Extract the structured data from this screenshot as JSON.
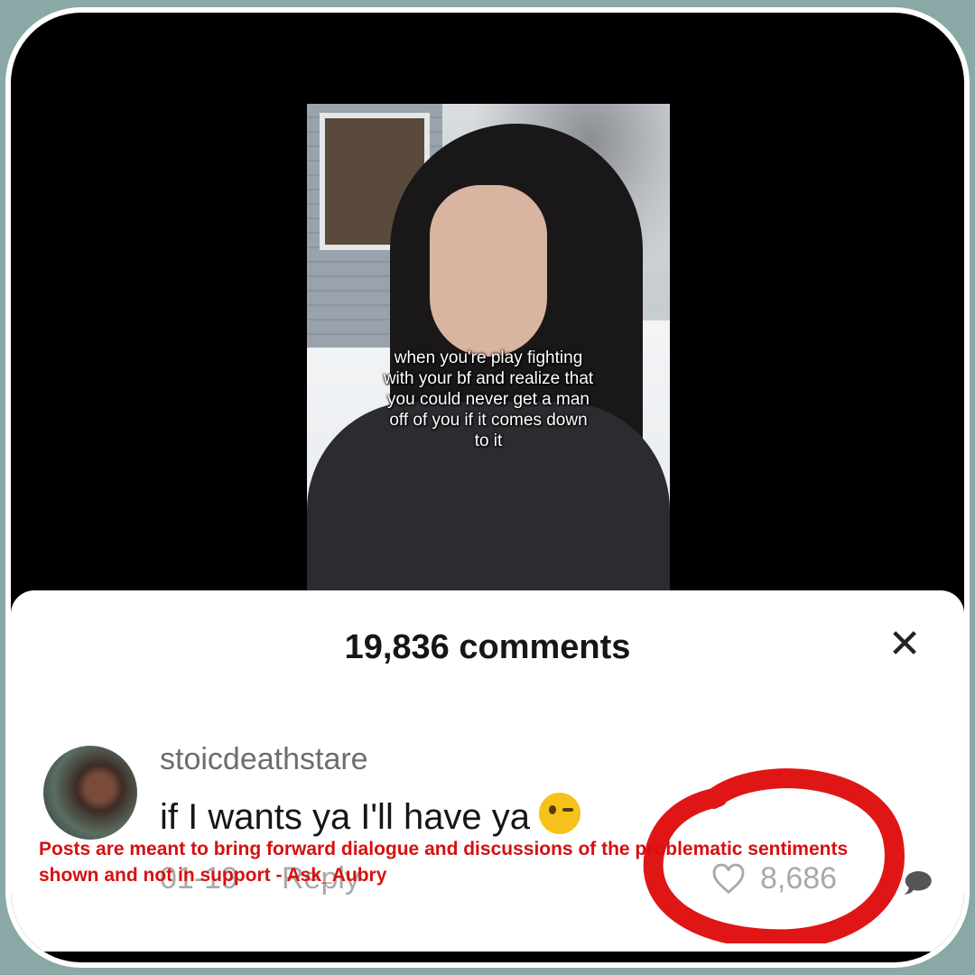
{
  "video": {
    "caption": "when you're play fighting\nwith your bf and realize that\nyou could never get a man\noff of you if it comes down\nto it"
  },
  "comments_sheet": {
    "title": "19,836 comments",
    "close_icon": "close-icon"
  },
  "comment": {
    "username": "stoicdeathstare",
    "text": "if I wants ya I'll have ya",
    "emoji": "wink-emoji",
    "date": "01-19",
    "reply_label": "Reply",
    "likes": "8,686"
  },
  "overlay": {
    "disclaimer": "Posts are meant to bring forward dialogue and discussions of the problematic sentiments shown and not in support - Ask_Aubry",
    "color": "#d80f0f"
  },
  "colors": {
    "frame": "#8aa9a6",
    "annotation_circle": "#e01616"
  }
}
